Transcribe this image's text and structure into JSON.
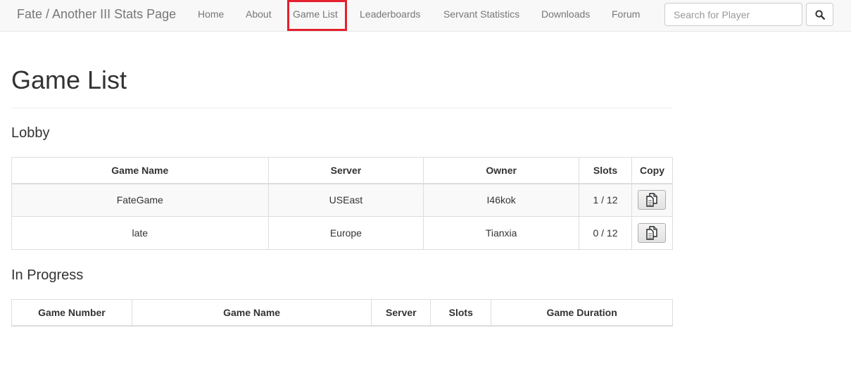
{
  "navbar": {
    "brand": "Fate / Another III Stats Page",
    "links": [
      "Home",
      "About",
      "Game List",
      "Leaderboards",
      "Servant Statistics",
      "Downloads",
      "Forum"
    ],
    "active": "Game List",
    "search_placeholder": "Search for Player",
    "search_icon": "search-icon",
    "highlight_color": "#e4202e"
  },
  "page": {
    "title": "Game List",
    "lobby": {
      "heading": "Lobby",
      "columns": [
        "Game Name",
        "Server",
        "Owner",
        "Slots",
        "Copy"
      ],
      "rows": [
        {
          "game_name": "FateGame",
          "server": "USEast",
          "owner": "I46kok",
          "slots": "1 / 12",
          "copy_icon": "copy-icon"
        },
        {
          "game_name": "late",
          "server": "Europe",
          "owner": "Tianxia",
          "slots": "0 / 12",
          "copy_icon": "copy-icon"
        }
      ]
    },
    "in_progress": {
      "heading": "In Progress",
      "columns": [
        "Game Number",
        "Game Name",
        "Server",
        "Slots",
        "Game Duration"
      ],
      "rows": []
    }
  }
}
